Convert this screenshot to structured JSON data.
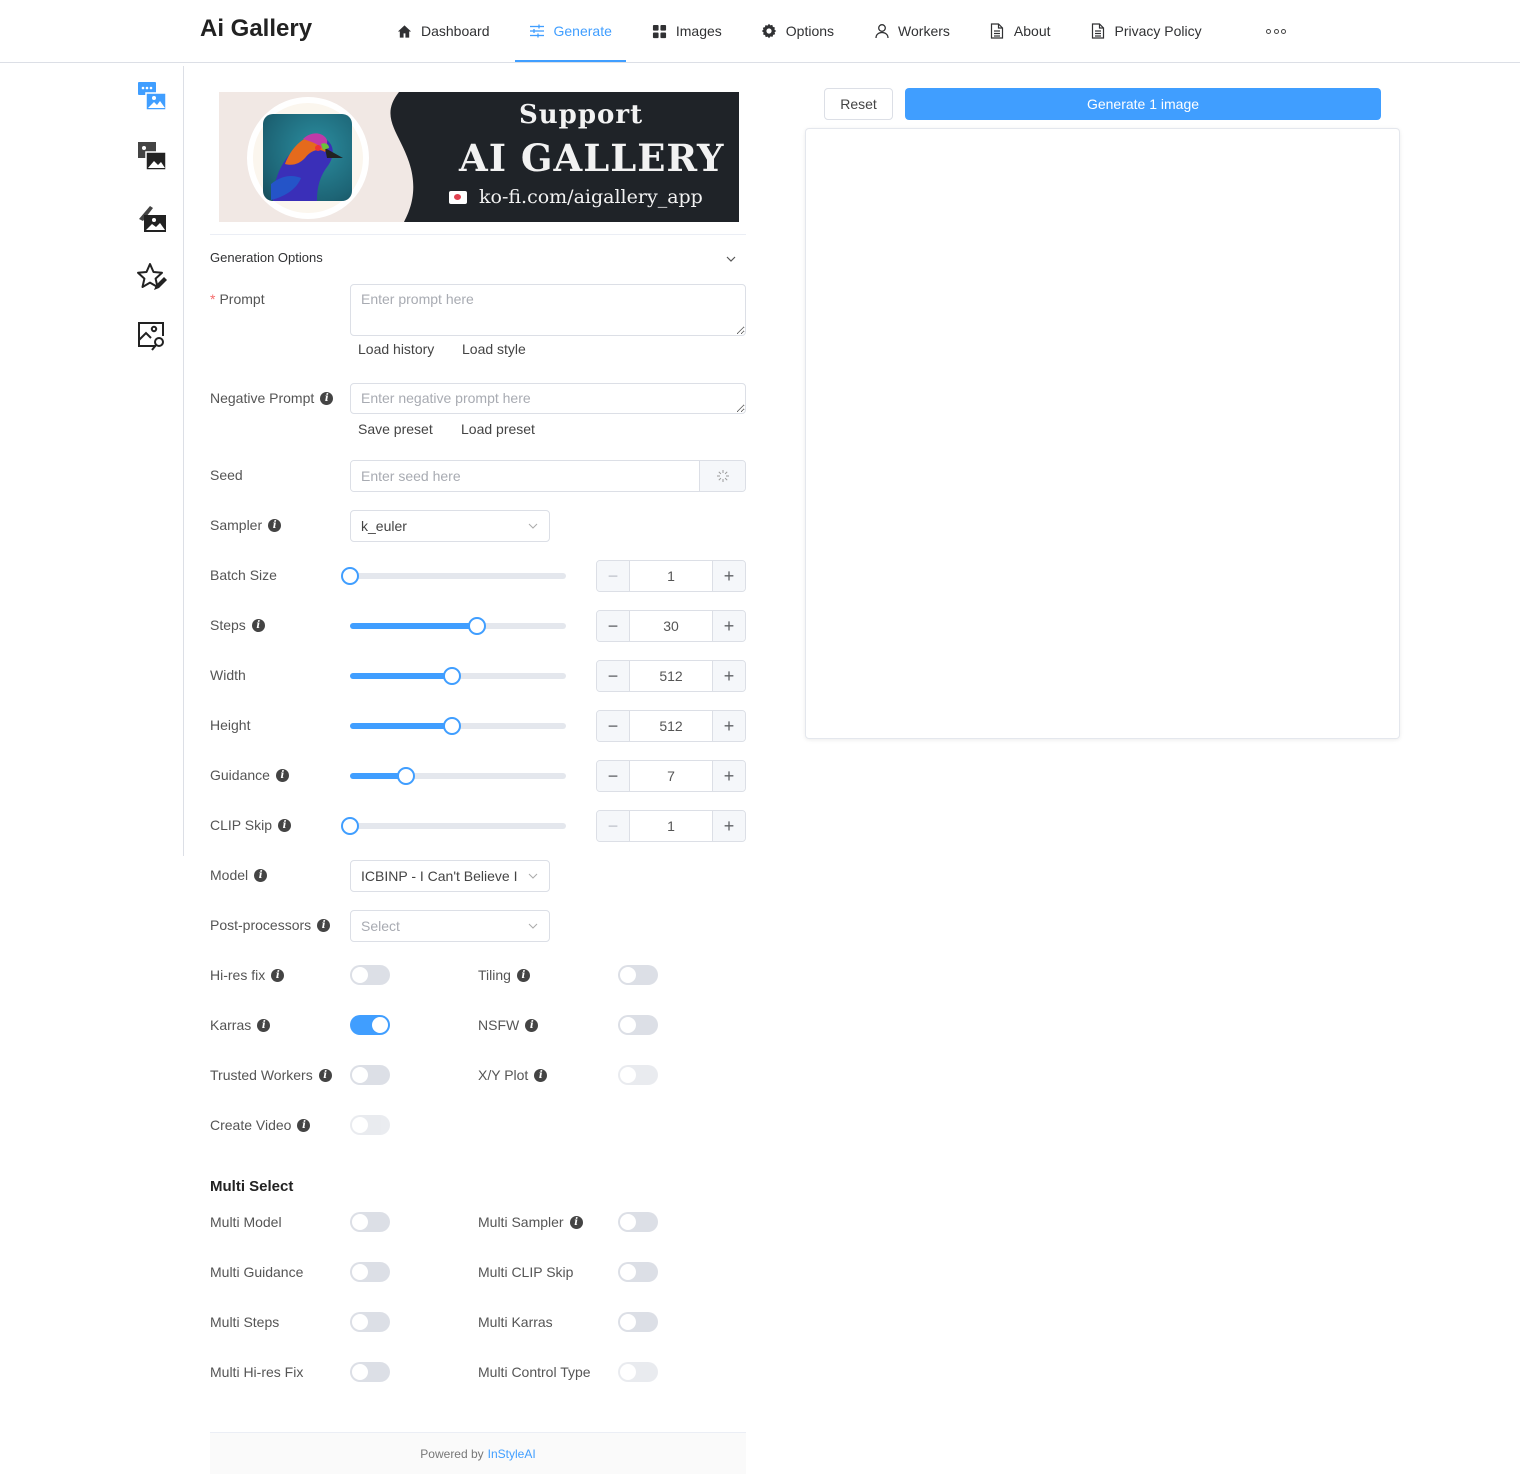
{
  "header": {
    "brand": "Ai Gallery",
    "nav": [
      {
        "label": "Dashboard",
        "icon": "home-icon",
        "active": false
      },
      {
        "label": "Generate",
        "icon": "sliders-icon",
        "active": true
      },
      {
        "label": "Images",
        "icon": "grid-icon",
        "active": false
      },
      {
        "label": "Options",
        "icon": "gear-icon",
        "active": false
      },
      {
        "label": "Workers",
        "icon": "user-icon",
        "active": false
      },
      {
        "label": "About",
        "icon": "document-icon",
        "active": false
      },
      {
        "label": "Privacy Policy",
        "icon": "document-icon",
        "active": false
      }
    ],
    "more_icon": "more-horizontal-icon"
  },
  "sidebar": {
    "items": [
      {
        "name": "text-to-image",
        "icon": "text-to-image-icon",
        "active": true
      },
      {
        "name": "image-to-image",
        "icon": "image-to-image-icon",
        "active": false
      },
      {
        "name": "inpainting",
        "icon": "inpaint-icon",
        "active": false
      },
      {
        "name": "rate",
        "icon": "star-pencil-icon",
        "active": false
      },
      {
        "name": "interrogate",
        "icon": "image-search-icon",
        "active": false
      }
    ]
  },
  "banner": {
    "line1": "Support",
    "line2": "AI GALLERY",
    "line3": "ko-fi.com/aigallery_app"
  },
  "form": {
    "section_title": "Generation Options",
    "prompt": {
      "label": "Prompt",
      "required_mark": "*",
      "placeholder": "Enter prompt here",
      "value": ""
    },
    "prompt_actions": {
      "load_history": "Load history",
      "load_style": "Load style"
    },
    "negative_prompt": {
      "label": "Negative Prompt",
      "placeholder": "Enter negative prompt here",
      "value": ""
    },
    "negative_actions": {
      "save_preset": "Save preset",
      "load_preset": "Load preset"
    },
    "seed": {
      "label": "Seed",
      "placeholder": "Enter seed here",
      "value": "",
      "append_icon": "randomize-icon"
    },
    "sampler": {
      "label": "Sampler",
      "value": "k_euler"
    },
    "sliders": [
      {
        "key": "batch_size",
        "label": "Batch Size",
        "info": false,
        "value": "1",
        "fraction": 0.0,
        "minus_disabled": true
      },
      {
        "key": "steps",
        "label": "Steps",
        "info": true,
        "value": "30",
        "fraction": 0.59,
        "minus_disabled": false
      },
      {
        "key": "width",
        "label": "Width",
        "info": false,
        "value": "512",
        "fraction": 0.47,
        "minus_disabled": false
      },
      {
        "key": "height",
        "label": "Height",
        "info": false,
        "value": "512",
        "fraction": 0.47,
        "minus_disabled": false
      },
      {
        "key": "guidance",
        "label": "Guidance",
        "info": true,
        "value": "7",
        "fraction": 0.26,
        "minus_disabled": false
      },
      {
        "key": "clip_skip",
        "label": "CLIP Skip",
        "info": true,
        "value": "1",
        "fraction": 0.0,
        "minus_disabled": true
      }
    ],
    "model": {
      "label": "Model",
      "value": "ICBINP - I Can't Believe I"
    },
    "post_processors": {
      "label": "Post-processors",
      "placeholder": "Select"
    },
    "toggles": [
      {
        "label": "Hi-res fix",
        "info": true,
        "on": false,
        "disabled": false
      },
      {
        "label": "Tiling",
        "info": true,
        "on": false,
        "disabled": false
      },
      {
        "label": "Karras",
        "info": true,
        "on": true,
        "disabled": false
      },
      {
        "label": "NSFW",
        "info": true,
        "on": false,
        "disabled": false
      },
      {
        "label": "Trusted Workers",
        "info": true,
        "on": false,
        "disabled": false
      },
      {
        "label": "X/Y Plot",
        "info": true,
        "on": false,
        "disabled": true
      },
      {
        "label": "Create Video",
        "info": true,
        "on": false,
        "disabled": true
      }
    ],
    "multi_select": {
      "title": "Multi Select",
      "toggles": [
        {
          "label": "Multi Model",
          "info": false,
          "on": false,
          "disabled": false
        },
        {
          "label": "Multi Sampler",
          "info": true,
          "on": false,
          "disabled": false
        },
        {
          "label": "Multi Guidance",
          "info": false,
          "on": false,
          "disabled": false
        },
        {
          "label": "Multi CLIP Skip",
          "info": false,
          "on": false,
          "disabled": false
        },
        {
          "label": "Multi Steps",
          "info": false,
          "on": false,
          "disabled": false
        },
        {
          "label": "Multi Karras",
          "info": false,
          "on": false,
          "disabled": false
        },
        {
          "label": "Multi Hi-res Fix",
          "info": false,
          "on": false,
          "disabled": false
        },
        {
          "label": "Multi Control Type",
          "info": false,
          "on": false,
          "disabled": true
        }
      ]
    }
  },
  "footer": {
    "prefix": "Powered by",
    "link": "InStyleAI"
  },
  "actions": {
    "reset": "Reset",
    "generate": "Generate 1 image"
  },
  "colors": {
    "accent": "#409eff",
    "switch_off": "#dcdfe6",
    "required": "#f56c6c"
  }
}
